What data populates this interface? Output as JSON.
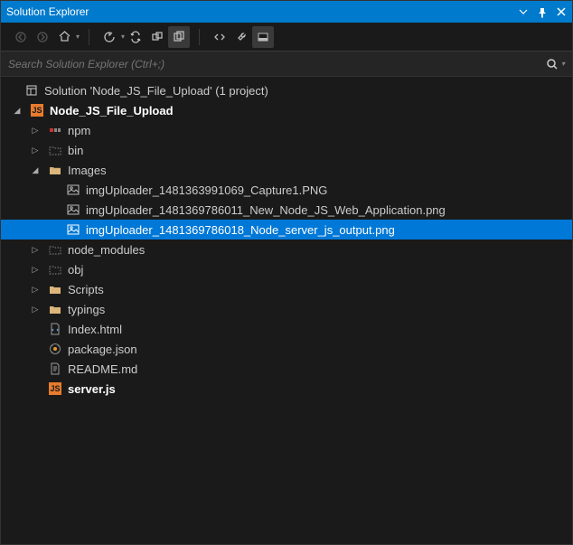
{
  "title": "Solution Explorer",
  "search_placeholder": "Search Solution Explorer (Ctrl+;)",
  "solution": {
    "label": "Solution 'Node_JS_File_Upload' (1 project)",
    "project": "Node_JS_File_Upload",
    "items": {
      "npm": "npm",
      "bin": "bin",
      "images": "Images",
      "img1": "imgUploader_1481363991069_Capture1.PNG",
      "img2": "imgUploader_1481369786011_New_Node_JS_Web_Application.png",
      "img3": "imgUploader_1481369786018_Node_server_js_output.png",
      "node_modules": "node_modules",
      "obj": "obj",
      "scripts": "Scripts",
      "typings": "typings",
      "index": "Index.html",
      "package": "package.json",
      "readme": "README.md",
      "server": "server.js"
    }
  },
  "icons": {
    "js": "JS"
  }
}
